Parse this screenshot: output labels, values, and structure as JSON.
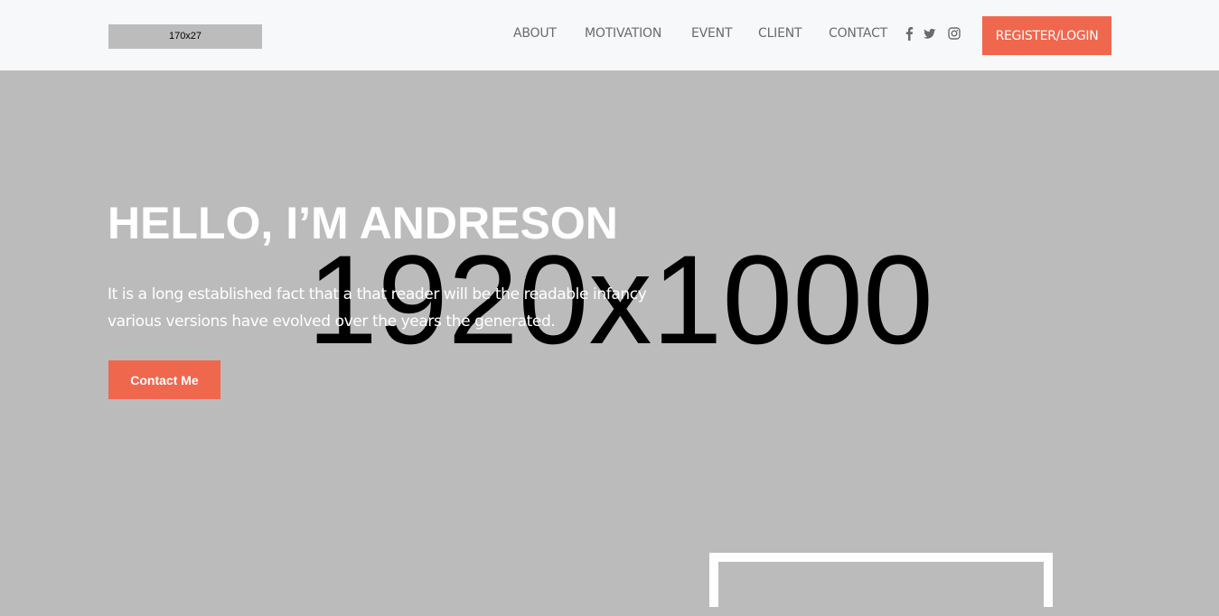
{
  "header": {
    "logo_text": "170x27",
    "nav": [
      "ABOUT",
      "MOTIVATION",
      "EVENT",
      "CLIENT",
      "CONTACT"
    ],
    "social_icons": [
      "facebook-icon",
      "twitter-icon",
      "instagram-icon"
    ],
    "register_label": "REGISTER/LOGIN"
  },
  "hero": {
    "background_placeholder": "1920x1000",
    "title": "HELLO, I’M ANDRESON",
    "description": "It is a long established fact that a that reader will be the readable infancy various versions have evolved over the years the generated.",
    "button_label": "Contact Me"
  },
  "colors": {
    "accent": "#ef674d",
    "header_bg": "#f7f8fa",
    "hero_bg": "#bbbbbb",
    "nav_text": "#6b6b6b"
  }
}
